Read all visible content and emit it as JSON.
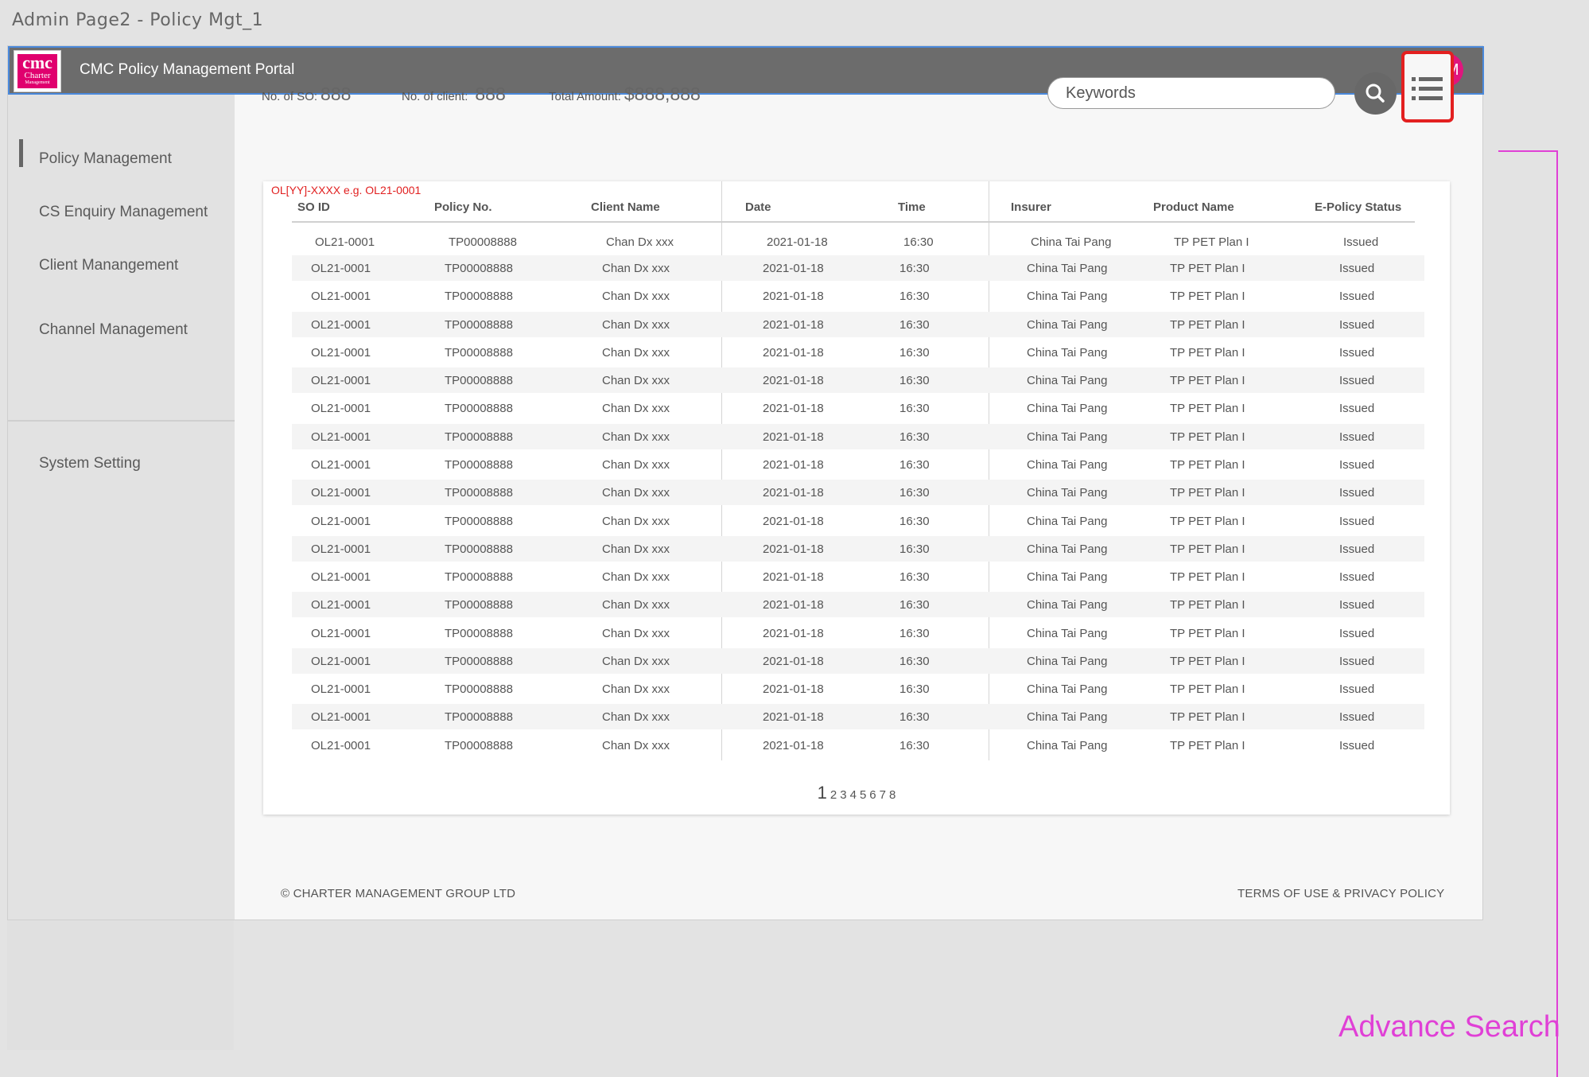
{
  "page_caption": "Admin Page2 - Policy Mgt_1",
  "header": {
    "logo": {
      "line1": "cmc",
      "line2": "Charter",
      "line3": "Management"
    },
    "title": "CMC Policy Management Portal",
    "avatar": "DM"
  },
  "sidebar": {
    "items": [
      {
        "label": "Policy  Management",
        "active": true
      },
      {
        "label": "CS Enquiry Management"
      },
      {
        "label": "Client Manangement"
      },
      {
        "label": "Channel Management"
      },
      {
        "label": "System Setting"
      }
    ]
  },
  "stats": {
    "so_label": "No. of SO:",
    "so_value": "888",
    "client_label": "No. of client:",
    "client_value": "888",
    "amount_label": "Total Amount:",
    "amount_value": "$888,888"
  },
  "search": {
    "placeholder": "Keywords",
    "button_icon": "search-icon",
    "menu_icon": "list-menu-icon"
  },
  "annotation": {
    "label": "Advance Search",
    "color": "#e040d6"
  },
  "table": {
    "format_hint": "OL[YY]-XXXX e.g. OL21-0001",
    "columns": [
      "SO ID",
      "Policy No.",
      "Client Name",
      "Date",
      "Time",
      "Insurer",
      "Product Name",
      "E-Policy Status"
    ],
    "rows": [
      [
        "OL21-0001",
        "TP00008888",
        "Chan Dx xxx",
        "2021-01-18",
        "16:30",
        "China Tai Pang",
        "TP PET Plan I",
        "Issued"
      ],
      [
        "OL21-0001",
        "TP00008888",
        "Chan Dx xxx",
        "2021-01-18",
        "16:30",
        "China Tai Pang",
        "TP PET Plan I",
        "Issued"
      ],
      [
        "OL21-0001",
        "TP00008888",
        "Chan Dx xxx",
        "2021-01-18",
        "16:30",
        "China Tai Pang",
        "TP PET Plan I",
        "Issued"
      ],
      [
        "OL21-0001",
        "TP00008888",
        "Chan Dx xxx",
        "2021-01-18",
        "16:30",
        "China Tai Pang",
        "TP PET Plan I",
        "Issued"
      ],
      [
        "OL21-0001",
        "TP00008888",
        "Chan Dx xxx",
        "2021-01-18",
        "16:30",
        "China Tai Pang",
        "TP PET Plan I",
        "Issued"
      ],
      [
        "OL21-0001",
        "TP00008888",
        "Chan Dx xxx",
        "2021-01-18",
        "16:30",
        "China Tai Pang",
        "TP PET Plan I",
        "Issued"
      ],
      [
        "OL21-0001",
        "TP00008888",
        "Chan Dx xxx",
        "2021-01-18",
        "16:30",
        "China Tai Pang",
        "TP PET Plan I",
        "Issued"
      ],
      [
        "OL21-0001",
        "TP00008888",
        "Chan Dx xxx",
        "2021-01-18",
        "16:30",
        "China Tai Pang",
        "TP PET Plan I",
        "Issued"
      ],
      [
        "OL21-0001",
        "TP00008888",
        "Chan Dx xxx",
        "2021-01-18",
        "16:30",
        "China Tai Pang",
        "TP PET Plan I",
        "Issued"
      ],
      [
        "OL21-0001",
        "TP00008888",
        "Chan Dx xxx",
        "2021-01-18",
        "16:30",
        "China Tai Pang",
        "TP PET Plan I",
        "Issued"
      ],
      [
        "OL21-0001",
        "TP00008888",
        "Chan Dx xxx",
        "2021-01-18",
        "16:30",
        "China Tai Pang",
        "TP PET Plan I",
        "Issued"
      ],
      [
        "OL21-0001",
        "TP00008888",
        "Chan Dx xxx",
        "2021-01-18",
        "16:30",
        "China Tai Pang",
        "TP PET Plan I",
        "Issued"
      ],
      [
        "OL21-0001",
        "TP00008888",
        "Chan Dx xxx",
        "2021-01-18",
        "16:30",
        "China Tai Pang",
        "TP PET Plan I",
        "Issued"
      ],
      [
        "OL21-0001",
        "TP00008888",
        "Chan Dx xxx",
        "2021-01-18",
        "16:30",
        "China Tai Pang",
        "TP PET Plan I",
        "Issued"
      ],
      [
        "OL21-0001",
        "TP00008888",
        "Chan Dx xxx",
        "2021-01-18",
        "16:30",
        "China Tai Pang",
        "TP PET Plan I",
        "Issued"
      ],
      [
        "OL21-0001",
        "TP00008888",
        "Chan Dx xxx",
        "2021-01-18",
        "16:30",
        "China Tai Pang",
        "TP PET Plan I",
        "Issued"
      ],
      [
        "OL21-0001",
        "TP00008888",
        "Chan Dx xxx",
        "2021-01-18",
        "16:30",
        "China Tai Pang",
        "TP PET Plan I",
        "Issued"
      ],
      [
        "OL21-0001",
        "TP00008888",
        "Chan Dx xxx",
        "2021-01-18",
        "16:30",
        "China Tai Pang",
        "TP PET Plan I",
        "Issued"
      ],
      [
        "OL21-0001",
        "TP00008888",
        "Chan Dx xxx",
        "2021-01-18",
        "16:30",
        "China Tai Pang",
        "TP PET Plan I",
        "Issued"
      ]
    ]
  },
  "pagination": {
    "current": "1",
    "pages": [
      "1",
      "2",
      "3",
      "4",
      "5",
      "6",
      "7",
      "8"
    ]
  },
  "footer": {
    "copyright": "© CHARTER MANAGEMENT GROUP LTD",
    "links": "TERMS OF USE & PRIVACY POLICY"
  }
}
